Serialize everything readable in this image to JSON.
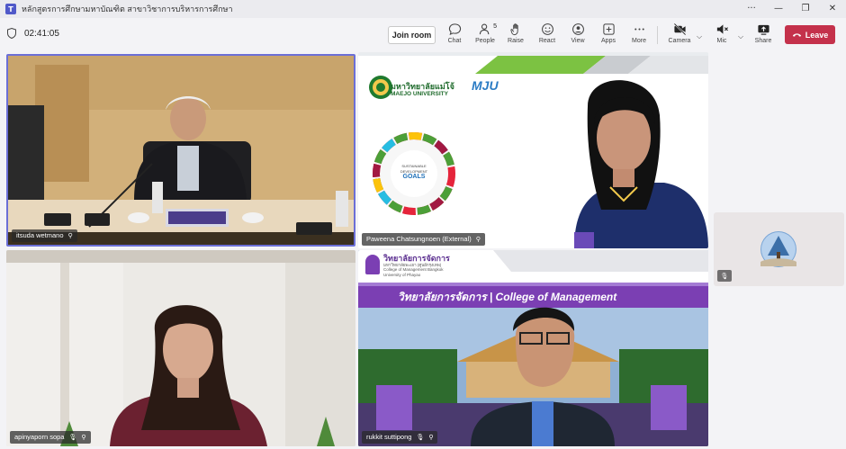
{
  "window": {
    "title": "หลักสูตรการศึกษามหาบัณฑิต สาขาวิชาการบริหารการศึกษา",
    "controls": [
      "···",
      "—",
      "❐",
      "✕"
    ]
  },
  "meeting": {
    "timer": "02:41:05",
    "join_room": "Join room",
    "leave": "Leave"
  },
  "toolbar": {
    "chat": "Chat",
    "people": "People",
    "people_count": "5",
    "raise": "Raise",
    "react": "React",
    "view": "View",
    "apps": "Apps",
    "more": "More",
    "camera": "Camera",
    "mic": "Mic",
    "share": "Share"
  },
  "participants": [
    {
      "name": "itsuda wetmano"
    },
    {
      "name": "Paweena Chatsungnoen (External)"
    },
    {
      "name": "apinyaporn sopa"
    },
    {
      "name": "rukkit suttipong"
    }
  ],
  "slides": {
    "maejo_thai": "มหาวิทยาลัยแม่โจ้",
    "maejo_en": "MAEJO UNIVERSITY",
    "mju": "MJU",
    "sdg_line1": "SUSTAINABLE",
    "sdg_line2": "DEVELOPMENT",
    "sdg_line3": "GOALS",
    "college_thai": "วิทยาลัยการจัดการ",
    "college_thai_sub": "มหาวิทยาลัยพะเยา (ศูนย์กรุงเทพ)",
    "college_en1": "College of Management Bangkok",
    "college_en2": "University of Phayao",
    "banner": "วิทยาลัยการจัดการ | College of Management"
  },
  "colors": {
    "accent": "#6b6fd6",
    "leave": "#c4314b",
    "banner": "#7b3fb3",
    "maejo_green": "#2e8b3a"
  }
}
